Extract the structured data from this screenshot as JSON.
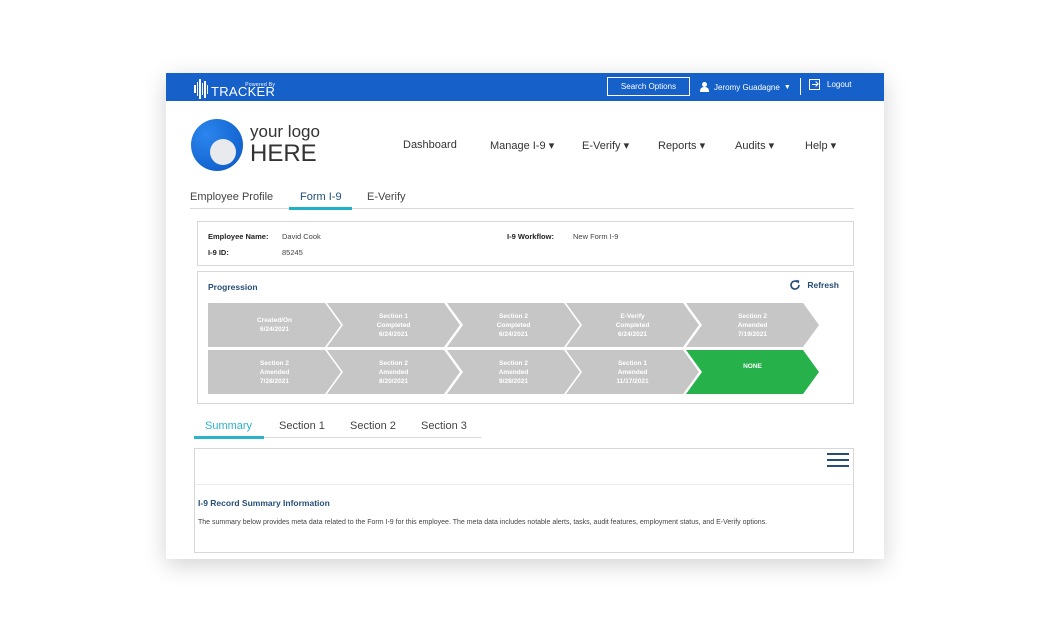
{
  "topbar": {
    "brand_powered": "Powered By",
    "brand_name": "TRACKER",
    "search_label": "Search Options",
    "user_name": "Jeromy Guadagne",
    "logout_label": "Logout",
    "bg_color": "#1660c9"
  },
  "logo": {
    "line1": "your logo",
    "line2": "HERE"
  },
  "mainnav": {
    "items": [
      {
        "label": "Dashboard"
      },
      {
        "label": "Manage I-9 ▾"
      },
      {
        "label": "E-Verify ▾"
      },
      {
        "label": "Reports ▾"
      },
      {
        "label": "Audits ▾"
      },
      {
        "label": "Help ▾"
      }
    ]
  },
  "subtabs": {
    "items": [
      {
        "label": "Employee Profile"
      },
      {
        "label": "Form I-9"
      },
      {
        "label": "E-Verify"
      }
    ],
    "active": "Form I-9"
  },
  "employee": {
    "name_label": "Employee Name:",
    "name_value": "David Cook",
    "id_label": "I-9 ID:",
    "id_value": "85245",
    "workflow_label": "I-9 Workflow:",
    "workflow_value": "New Form I-9"
  },
  "progression": {
    "title": "Progression",
    "refresh_label": "Refresh",
    "steps": [
      {
        "label": "Created/On\n6/24/2021",
        "status": "done"
      },
      {
        "label": "Section 1\nCompleted\n6/24/2021",
        "status": "done"
      },
      {
        "label": "Section 2\nCompleted\n6/24/2021",
        "status": "done"
      },
      {
        "label": "E-Verify\nCompleted\n6/24/2021",
        "status": "done"
      },
      {
        "label": "Section 2\nAmended\n7/19/2021",
        "status": "done"
      },
      {
        "label": "Section 2\nAmended\n7/28/2021",
        "status": "done"
      },
      {
        "label": "Section 2\nAmended\n8/20/2021",
        "status": "done"
      },
      {
        "label": "Section 2\nAmended\n9/28/2021",
        "status": "done"
      },
      {
        "label": "Section 1\nAmended\n11/17/2021",
        "status": "done"
      },
      {
        "label": "NONE",
        "status": "current"
      }
    ],
    "done_color": "#c6c6c6",
    "current_color": "#26b14b"
  },
  "lowertabs": {
    "items": [
      {
        "label": "Summary"
      },
      {
        "label": "Section 1"
      },
      {
        "label": "Section 2"
      },
      {
        "label": "Section 3"
      }
    ],
    "active": "Summary"
  },
  "summary": {
    "title": "I-9 Record Summary Information",
    "text": "The summary below provides meta data related to the Form I-9 for this employee. The meta data includes notable alerts, tasks, audit features, employment status, and E-Verify options."
  }
}
